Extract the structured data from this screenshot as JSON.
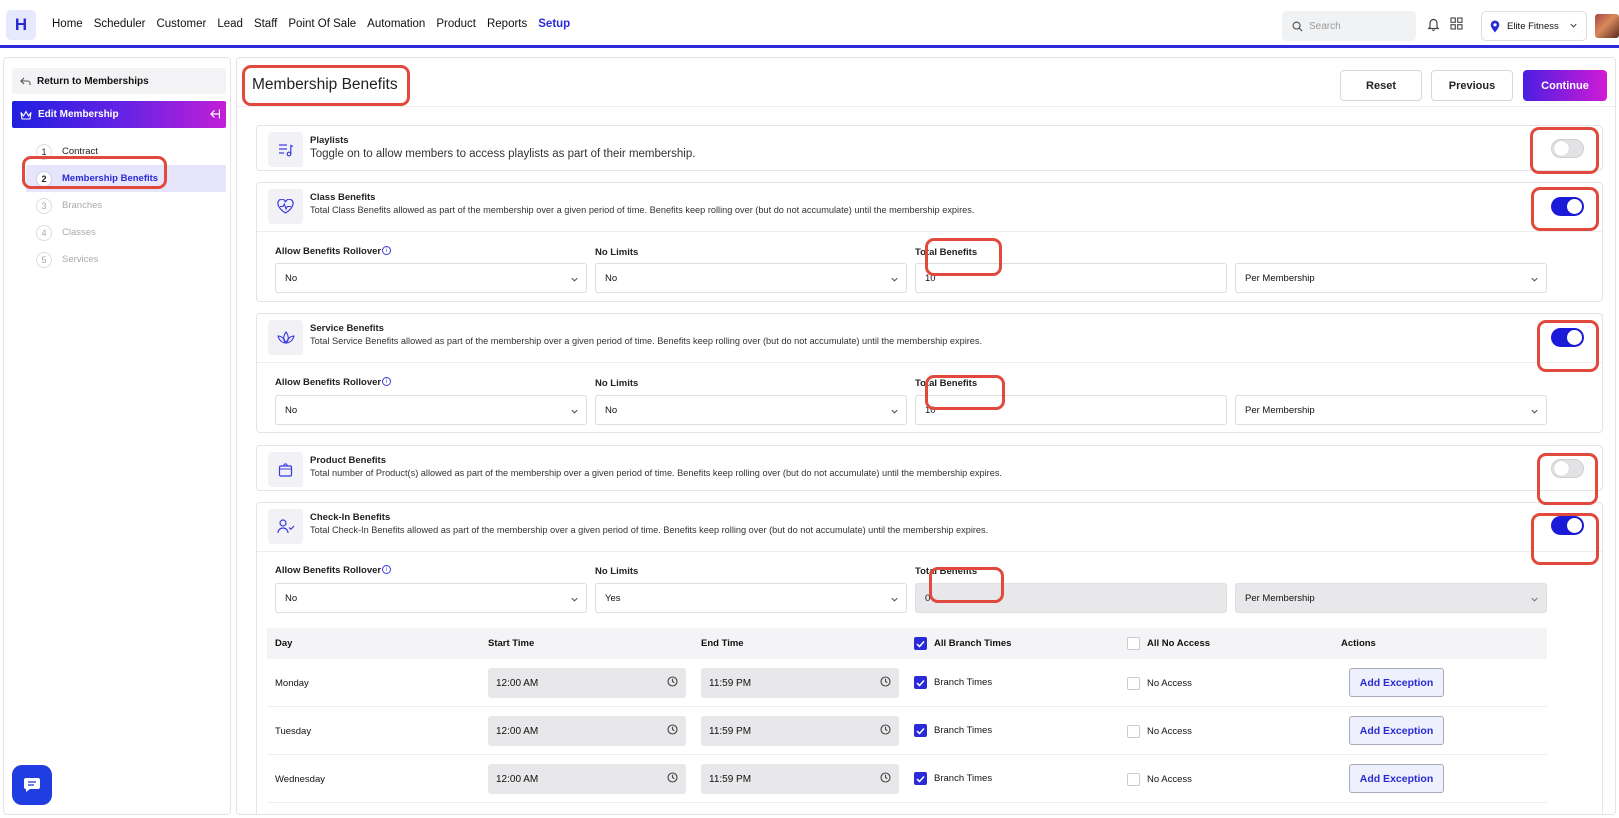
{
  "nav": {
    "logo": "H",
    "items": [
      "Home",
      "Scheduler",
      "Customer",
      "Lead",
      "Staff",
      "Point Of Sale",
      "Automation",
      "Product",
      "Reports",
      "Setup"
    ],
    "active": "Setup",
    "search_placeholder": "Search",
    "location": "Elite Fitness"
  },
  "sidebar": {
    "back_label": "Return to Memberships",
    "edit_label": "Edit Membership",
    "steps": [
      {
        "num": "1",
        "label": "Contract",
        "state": "done"
      },
      {
        "num": "2",
        "label": "Membership Benefits",
        "state": "active"
      },
      {
        "num": "3",
        "label": "Branches",
        "state": "pending"
      },
      {
        "num": "4",
        "label": "Classes",
        "state": "pending"
      },
      {
        "num": "5",
        "label": "Services",
        "state": "pending"
      }
    ]
  },
  "page": {
    "title": "Membership Benefits",
    "reset_label": "Reset",
    "previous_label": "Previous",
    "continue_label": "Continue"
  },
  "fields": {
    "rollover_label": "Allow Benefits Rollover",
    "no_limits_label": "No Limits",
    "total_label": "Total Benefits"
  },
  "benefits": {
    "playlists": {
      "title": "Playlists",
      "desc": "Toggle on to allow members to access playlists as part of their membership.",
      "enabled": false
    },
    "class": {
      "title": "Class Benefits",
      "desc": "Total Class Benefits allowed as part of the membership over a given period of time. Benefits keep rolling over (but do not accumulate) until the membership expires.",
      "enabled": true,
      "rollover": "No",
      "no_limits": "No",
      "total": "10",
      "period": "Per Membership"
    },
    "service": {
      "title": "Service Benefits",
      "desc": "Total Service Benefits allowed as part of the membership over a given period of time. Benefits keep rolling over (but do not accumulate) until the membership expires.",
      "enabled": true,
      "rollover": "No",
      "no_limits": "No",
      "total": "10",
      "period": "Per Membership"
    },
    "product": {
      "title": "Product Benefits",
      "desc": "Total number of Product(s) allowed as part of the membership over a given period of time. Benefits keep rolling over (but do not accumulate) until the membership expires.",
      "enabled": false
    },
    "checkin": {
      "title": "Check-In Benefits",
      "desc": "Total Check-In Benefits allowed as part of the membership over a given period of time. Benefits keep rolling over (but do not accumulate) until the membership expires.",
      "enabled": true,
      "rollover": "No",
      "no_limits": "Yes",
      "total": "0",
      "period": "Per Membership"
    }
  },
  "schedule": {
    "headers": {
      "day": "Day",
      "start": "Start Time",
      "end": "End Time",
      "all_branch": "All Branch Times",
      "all_no_access": "All No Access",
      "actions": "Actions"
    },
    "branch_label": "Branch Times",
    "no_access_label": "No Access",
    "action_label": "Add Exception",
    "rows": [
      {
        "day": "Monday",
        "start": "12:00 AM",
        "end": "11:59 PM"
      },
      {
        "day": "Tuesday",
        "start": "12:00 AM",
        "end": "11:59 PM"
      },
      {
        "day": "Wednesday",
        "start": "12:00 AM",
        "end": "11:59 PM"
      }
    ]
  },
  "colors": {
    "accent": "#2a2ad6",
    "highlight": "#e0493c",
    "toggle_on": "#1a1ad8"
  }
}
